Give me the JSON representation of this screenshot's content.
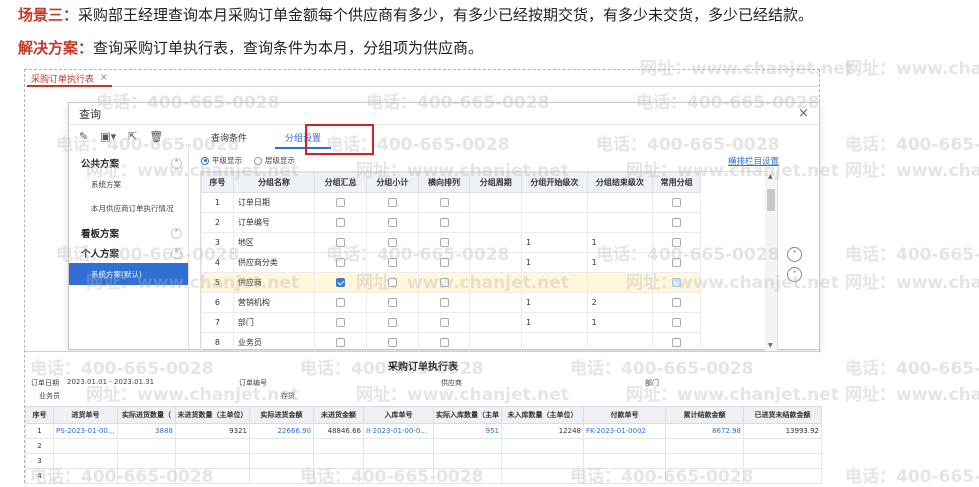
{
  "slide": {
    "scene_label": "场景三：",
    "scene_text": "采购部王经理查询本月采购订单金额每个供应商有多少，有多少已经按期交货，有多少未交货，多少已经结款。",
    "solution_label": "解决方案：",
    "solution_text": "查询采购订单执行表，查询条件为本月，分组项为供应商。"
  },
  "watermark": {
    "phone": "电话：400-665-0028",
    "site": "网址：www.chanjet.net"
  },
  "doc_tab": {
    "label": "采购订单执行表",
    "close": "×"
  },
  "dialog": {
    "title": "查询",
    "close": "×",
    "toolbar_icons": [
      "edit-icon",
      "save-icon",
      "export-icon",
      "delete-icon"
    ],
    "tabs": [
      "查询条件",
      "分组设置"
    ],
    "active_tab": "分组设置",
    "radios": [
      {
        "label": "平级显示",
        "checked": true
      },
      {
        "label": "层级显示",
        "checked": false
      }
    ],
    "right_link": "横排栏目设置",
    "schemes": {
      "public_group": "公共方案",
      "public_items": [
        "系统方案",
        "本月供应商订单执行情况"
      ],
      "board_group": "看板方案",
      "personal_group": "个人方案",
      "personal_items": [
        "系统方案(默认)"
      ]
    },
    "grid": {
      "columns": [
        "序号",
        "分组名称",
        "分组汇总",
        "分组小计",
        "横向排列",
        "分组周期",
        "分组开始级次",
        "分组结束级次",
        "常用分组"
      ],
      "rows": [
        {
          "no": "1",
          "name": "订单日期",
          "sum": false,
          "sub": false,
          "horiz": false,
          "period": "",
          "start": "",
          "end": "",
          "common": false
        },
        {
          "no": "2",
          "name": "订单编号",
          "sum": false,
          "sub": false,
          "horiz": false,
          "period": "",
          "start": "",
          "end": "",
          "common": false
        },
        {
          "no": "3",
          "name": "地区",
          "sum": false,
          "sub": false,
          "horiz": false,
          "period": "",
          "start": "1",
          "end": "1",
          "common": false
        },
        {
          "no": "4",
          "name": "供应商分类",
          "sum": false,
          "sub": false,
          "horiz": false,
          "period": "",
          "start": "1",
          "end": "1",
          "common": false
        },
        {
          "no": "5",
          "name": "供应商",
          "sum": true,
          "sub": false,
          "horiz": false,
          "period": "",
          "start": "",
          "end": "",
          "common": true,
          "highlight": true
        },
        {
          "no": "6",
          "name": "营销机构",
          "sum": false,
          "sub": false,
          "horiz": false,
          "period": "",
          "start": "1",
          "end": "2",
          "common": false
        },
        {
          "no": "7",
          "name": "部门",
          "sum": false,
          "sub": false,
          "horiz": false,
          "period": "",
          "start": "1",
          "end": "1",
          "common": false
        },
        {
          "no": "8",
          "name": "业务员",
          "sum": false,
          "sub": false,
          "horiz": false,
          "period": "",
          "start": "",
          "end": "",
          "common": false
        }
      ]
    }
  },
  "report": {
    "title": "采购订单执行表",
    "meta": {
      "order_date_label": "订单日期",
      "order_date_value": "2023.01.01 - 2023.01.31",
      "order_no_label": "订单编号",
      "supplier_label": "供应商",
      "dept_label": "部门",
      "salesman_label": "业务员",
      "stock_label": "存货"
    },
    "columns": [
      "序号",
      "进货单号",
      "实际进货数量（",
      "未进货数量（主单位）",
      "实际进货金额",
      "未进货金额",
      "入库单号",
      "实际入库数量（主单",
      "未入库数量（主单位）",
      "付款单号",
      "累计结款金额",
      "已进货未结款金额"
    ],
    "rows": [
      [
        "1",
        "PS-2023-01-00...",
        "3888",
        "9321",
        "22666.90",
        "48846.66",
        "II-2023-01-00-0...",
        "951",
        "12248",
        "FK-2023-01-0002",
        "8672.98",
        "13993.92"
      ],
      [
        "2",
        "",
        "",
        "",
        "",
        "",
        "",
        "",
        "",
        "",
        "",
        ""
      ],
      [
        "3",
        "",
        "",
        "",
        "",
        "",
        "",
        "",
        "",
        "",
        "",
        ""
      ],
      [
        "4",
        "",
        "",
        "",
        "",
        "",
        "",
        "",
        "",
        "",
        "",
        ""
      ]
    ]
  }
}
